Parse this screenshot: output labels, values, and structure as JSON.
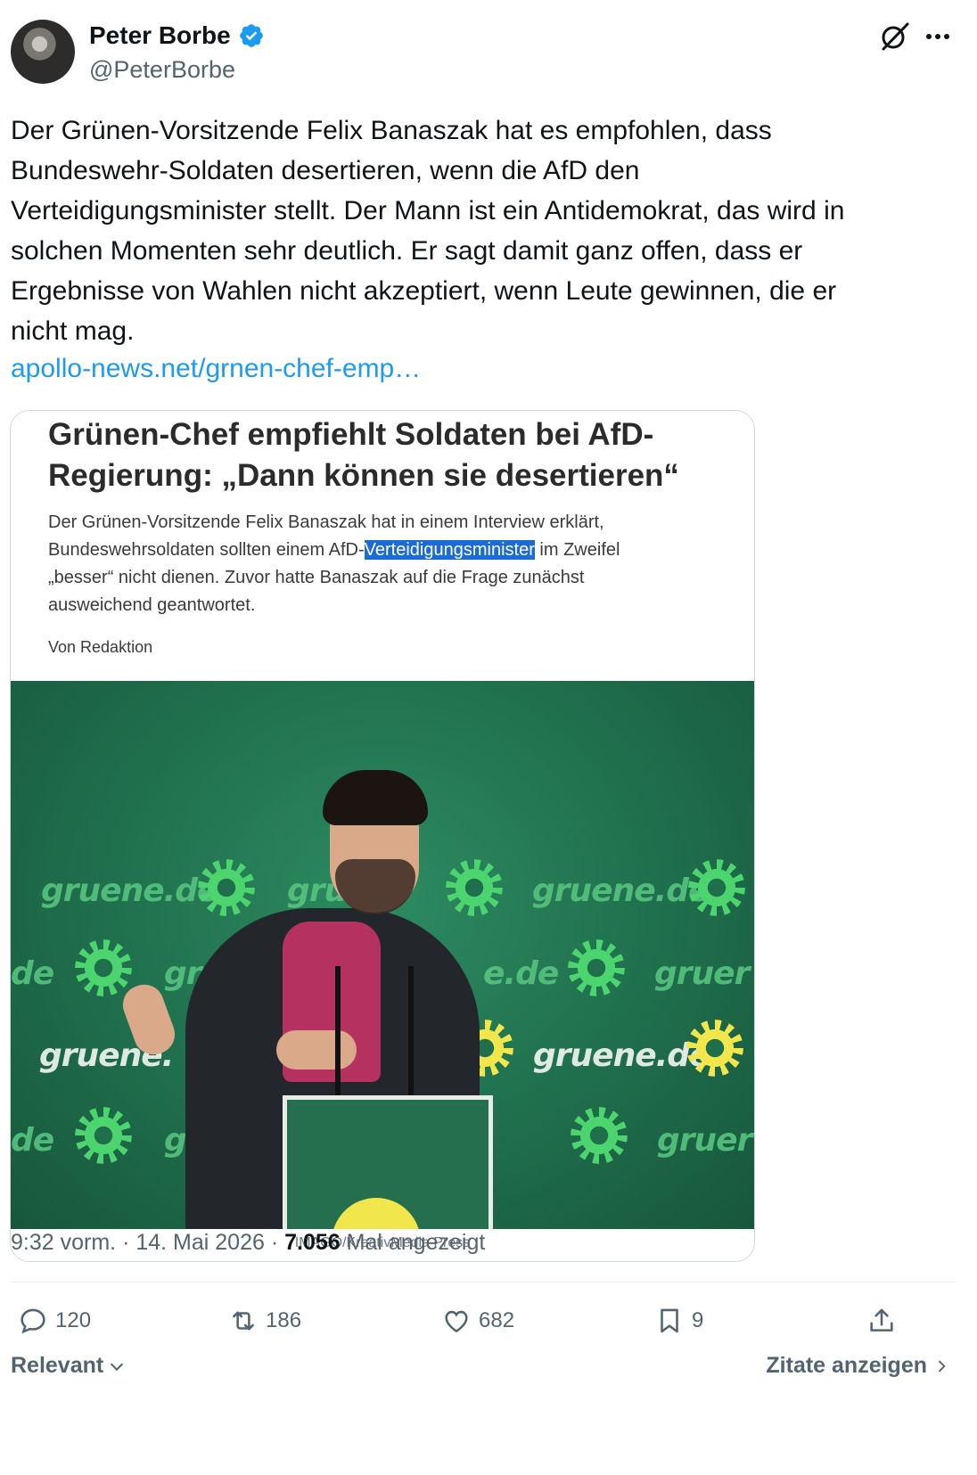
{
  "author": {
    "display_name": "Peter Borbe",
    "handle": "@PeterBorbe",
    "verified": true
  },
  "tweet": {
    "text": "Der Grünen-Vorsitzende Felix Banaszak hat es empfohlen, dass\nBundeswehr-Soldaten desertieren, wenn die AfD den\nVerteidigungsminister stellt. Der Mann ist ein Antidemokrat, das wird in\nsolchen Momenten sehr deutlich. Er sagt damit ganz offen, dass er\nErgebnisse von Wahlen nicht akzeptiert, wenn Leute gewinnen, die er\nnicht mag.",
    "link": "apollo-news.net/grnen-chef-emp…"
  },
  "article": {
    "title": "Grünen-Chef empfiehlt Soldaten bei AfD-Regierung: „Dann können sie desertieren“",
    "lead_part1": "Der Grünen-Vorsitzende Felix Banaszak hat in einem Interview erklärt, Bundeswehrsoldaten sollten einem AfD-",
    "lead_highlight": "Verteidigungsminister",
    "lead_part2": " im Zweifel „besser“ nicht dienen. Zuvor hatte Banaszak auf die Frage zunächst ausweichend geantwortet.",
    "author": "Von Redaktion",
    "photo_credit": "IMAGO/KreativMedia Press",
    "photo_watermarks": [
      "gruene.de",
      "gru",
      "gruene.de",
      "de",
      "gruen",
      "e.de",
      "gruer",
      "gruene.",
      "gruene.de",
      "de",
      "gru",
      "gruer"
    ]
  },
  "meta": {
    "time": "9:32 vorm.",
    "date": "14. Mai 2026",
    "views": "7.056",
    "views_label": "Mal angezeigt"
  },
  "actions": {
    "replies": "120",
    "reposts": "186",
    "likes": "682",
    "bookmarks": "9"
  },
  "footer": {
    "sort_label": "Relevant",
    "quotes_label": "Zitate anzeigen"
  },
  "colors": {
    "link": "#1d9bf0",
    "verified": "#1d9bf0",
    "secondary_text": "#536471"
  }
}
